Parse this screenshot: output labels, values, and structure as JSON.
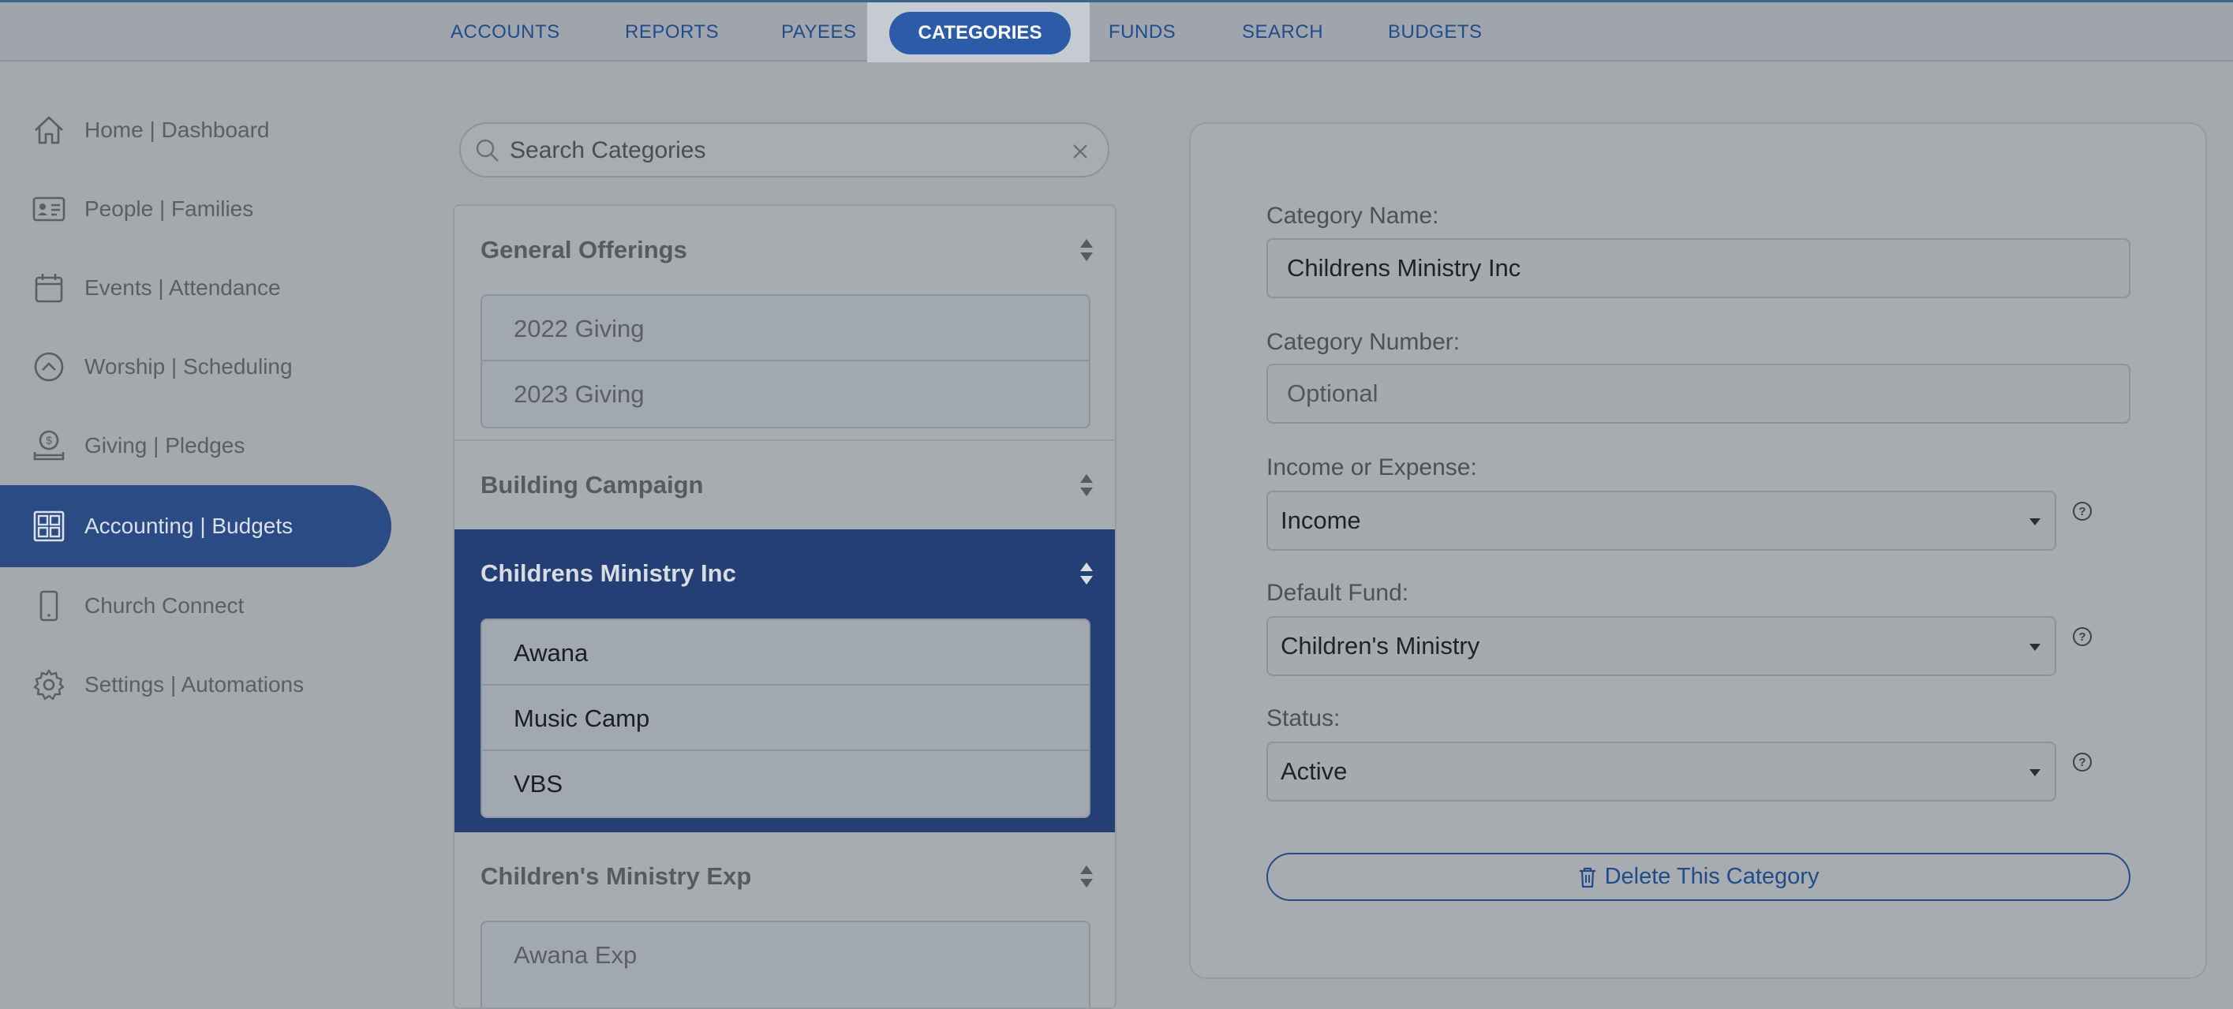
{
  "topnav": {
    "items": [
      "ACCOUNTS",
      "REPORTS",
      "PAYEES",
      "CATEGORIES",
      "FUNDS",
      "SEARCH",
      "BUDGETS"
    ],
    "active": "CATEGORIES"
  },
  "sidebar": {
    "items": [
      {
        "label": "Home | Dashboard",
        "icon": "home-icon"
      },
      {
        "label": "People | Families",
        "icon": "id-card-icon"
      },
      {
        "label": "Events | Attendance",
        "icon": "calendar-icon"
      },
      {
        "label": "Worship | Scheduling",
        "icon": "chevron-up-circle-icon"
      },
      {
        "label": "Giving | Pledges",
        "icon": "donation-icon"
      },
      {
        "label": "Accounting | Budgets",
        "icon": "grid-icon"
      },
      {
        "label": "Church Connect",
        "icon": "phone-icon"
      },
      {
        "label": "Settings | Automations",
        "icon": "gear-icon"
      }
    ],
    "active_index": 5
  },
  "search": {
    "placeholder": "Search Categories"
  },
  "categories": {
    "groups": [
      {
        "name": "General Offerings",
        "items": [
          "2022 Giving",
          "2023 Giving"
        ]
      },
      {
        "name": "Building Campaign",
        "items": []
      },
      {
        "name": "Childrens Ministry Inc",
        "items": [
          "Awana",
          "Music Camp",
          "VBS"
        ],
        "selected": true
      },
      {
        "name": "Children's Ministry Exp",
        "items": [
          "Awana Exp"
        ]
      }
    ]
  },
  "form": {
    "category_name_label": "Category Name:",
    "category_name_value": "Childrens Ministry Inc",
    "category_number_label": "Category Number:",
    "category_number_placeholder": "Optional",
    "income_expense_label": "Income or Expense:",
    "income_expense_value": "Income",
    "default_fund_label": "Default Fund:",
    "default_fund_value": "Children's Ministry",
    "status_label": "Status:",
    "status_value": "Active",
    "delete_label": "Delete This Category"
  },
  "colors": {
    "accent": "#2c5baa",
    "sidebar_active": "#2a4b84",
    "selected_group": "#233f73"
  }
}
